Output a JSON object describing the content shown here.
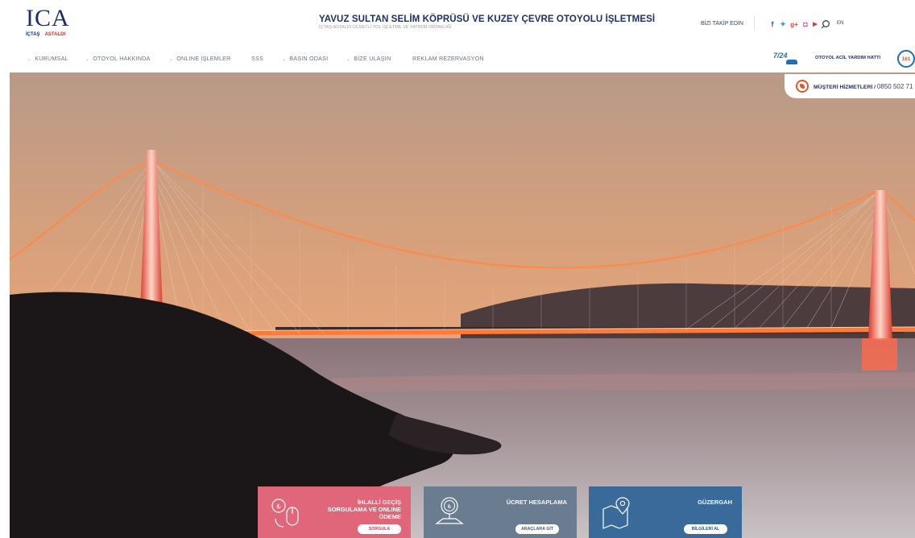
{
  "header": {
    "logo_mark": "ICA",
    "logo_partner_a": "İÇTAŞ",
    "logo_partner_b": "ASTALDI",
    "title": "YAVUZ SULTAN SELİM KÖPRÜSÜ VE KUZEY ÇEVRE OTOYOLU İŞLETMESİ",
    "subtitle": "İÇTAŞ-ASTALDI ÜCRETLİ YOL İŞLETME VE YATIRIM ORTAKLIĞI",
    "follow_label": "BİZİ TAKİP EDİN",
    "social_icons": [
      {
        "name": "facebook-icon",
        "glyph": "f",
        "color": "#3b5998"
      },
      {
        "name": "twitter-icon",
        "glyph": "✦",
        "color": "#1da1f2"
      },
      {
        "name": "google-plus-icon",
        "glyph": "g+",
        "color": "#dd4b39"
      },
      {
        "name": "instagram-icon",
        "glyph": "◘",
        "color": "#c13584"
      },
      {
        "name": "youtube-icon",
        "glyph": "▶",
        "color": "#e52d27"
      }
    ],
    "lang": "EN"
  },
  "nav": {
    "items": [
      "KURUMSAL",
      "OTOYOL HAKKINDA",
      "ONLINE İŞLEMLER",
      "SSS",
      "BASIN ODASI",
      "BİZE ULAŞIN",
      "REKLAM REZERVASYON"
    ],
    "emergency_badge": "7/24",
    "emergency_label": "OTOYOL ACİL YARDIM HATTI",
    "emergency_number": "161"
  },
  "customer_service": {
    "label": "MÜŞTERİ HİZMETLERİ /",
    "phone": "0850 502 71"
  },
  "cards": [
    {
      "title_top": "İHLALLİ GEÇİŞ",
      "title_bottom": "SORGULAMA VE ONLINE ÖDEME",
      "button": "SORGULA",
      "color": "#e0667a"
    },
    {
      "title_top": "ÜCRET HESAPLAMA",
      "title_bottom": "",
      "button": "ARAÇLARA GİT",
      "color": "#6a7d90"
    },
    {
      "title_top": "GÜZERGAH",
      "title_bottom": "",
      "button": "BİLGİLERİ AL",
      "color": "#3a6a99"
    }
  ]
}
